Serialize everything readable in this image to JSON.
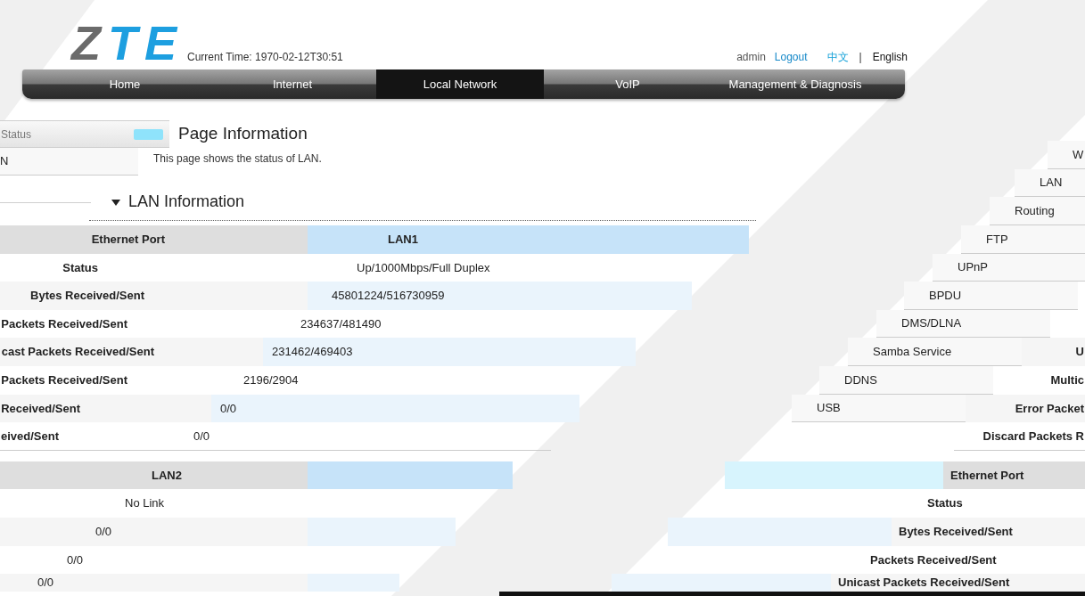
{
  "header": {
    "logo": "ZTE",
    "current_time": "Current Time: 1970-02-12T30:51",
    "user": "admin",
    "logout": "Logout",
    "languages": [
      {
        "label": "中文",
        "selected": false
      },
      {
        "label": "English",
        "selected": true
      }
    ],
    "separator": "|"
  },
  "nav": [
    {
      "label": "Home",
      "selected": false
    },
    {
      "label": "Internet",
      "selected": false
    },
    {
      "label": "Local Network",
      "selected": true
    },
    {
      "label": "VoIP",
      "selected": false
    },
    {
      "label": "Management & Diagnosis",
      "selected": false
    }
  ],
  "sidebar": {
    "title": "Status",
    "items": [
      {
        "label": "N"
      }
    ]
  },
  "page": {
    "title": "Page Information",
    "description": "This page shows the status of LAN."
  },
  "section": {
    "title": "LAN Information",
    "expanded": true
  },
  "side_menu": [
    {
      "label": "W"
    },
    {
      "label": "LAN"
    },
    {
      "label": "Routing"
    },
    {
      "label": "FTP"
    },
    {
      "label": "UPnP"
    },
    {
      "label": "BPDU"
    },
    {
      "label": "DMS/DLNA"
    },
    {
      "label": "Samba Service"
    },
    {
      "label": "DDNS"
    },
    {
      "label": "USB"
    }
  ],
  "tables": [
    {
      "header": {
        "label": "Ethernet Port",
        "value": "LAN1"
      },
      "rows": [
        {
          "label": "Status",
          "value": "Up/1000Mbps/Full Duplex"
        },
        {
          "label": "Bytes Received/Sent",
          "value": "45801224/516730959"
        },
        {
          "label": "Packets Received/Sent",
          "value": "234637/481490"
        },
        {
          "label": "cast Packets Received/Sent",
          "value": "231462/469403",
          "label_right": "U"
        },
        {
          "label": "Packets Received/Sent",
          "value": "2196/2904",
          "label_right": "Multic"
        },
        {
          "label": "Received/Sent",
          "value": "0/0",
          "label_right": "Error Packet"
        },
        {
          "label": "eived/Sent",
          "value": "0/0",
          "label_right": "Discard Packets R"
        }
      ]
    },
    {
      "header": {
        "value": "LAN2",
        "label_right": "Ethernet Port"
      },
      "rows": [
        {
          "value": "No Link",
          "label_right": "Status"
        },
        {
          "value": "0/0",
          "label_right": "Bytes Received/Sent"
        },
        {
          "value": "0/0",
          "label_right": "Packets Received/Sent"
        },
        {
          "value": "0/0",
          "label_right": "Unicast Packets Received/Sent"
        }
      ]
    }
  ]
}
